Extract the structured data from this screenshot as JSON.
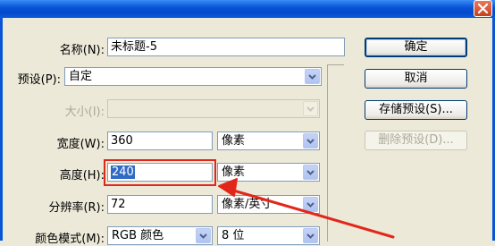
{
  "dialog": {
    "name_label": "名称(N):",
    "name_value": "未标题-5",
    "preset_label": "预设(P):",
    "preset_value": "自定",
    "size_label": "大小(I):",
    "size_value": "",
    "width_label": "宽度(W):",
    "width_value": "360",
    "width_unit": "像素",
    "height_label": "高度(H):",
    "height_value": "240",
    "height_unit": "像素",
    "resolution_label": "分辨率(R):",
    "resolution_value": "72",
    "resolution_unit": "像素/英寸",
    "color_mode_label": "颜色模式(M):",
    "color_mode_value": "RGB 颜色",
    "bit_depth_value": "8 位"
  },
  "buttons": {
    "ok": "确定",
    "cancel": "取消",
    "save_preset": "存储预设(S)...",
    "delete_preset": "删除预设(D)..."
  },
  "icons": {
    "close": "close-icon",
    "dropdown": "chevron-down-icon",
    "annotation": "red-arrow"
  },
  "colors": {
    "titlebar": "#0a56d8",
    "dialog_bg": "#ece9d8",
    "annotation": "#e3261a",
    "selection": "#316ac5"
  }
}
